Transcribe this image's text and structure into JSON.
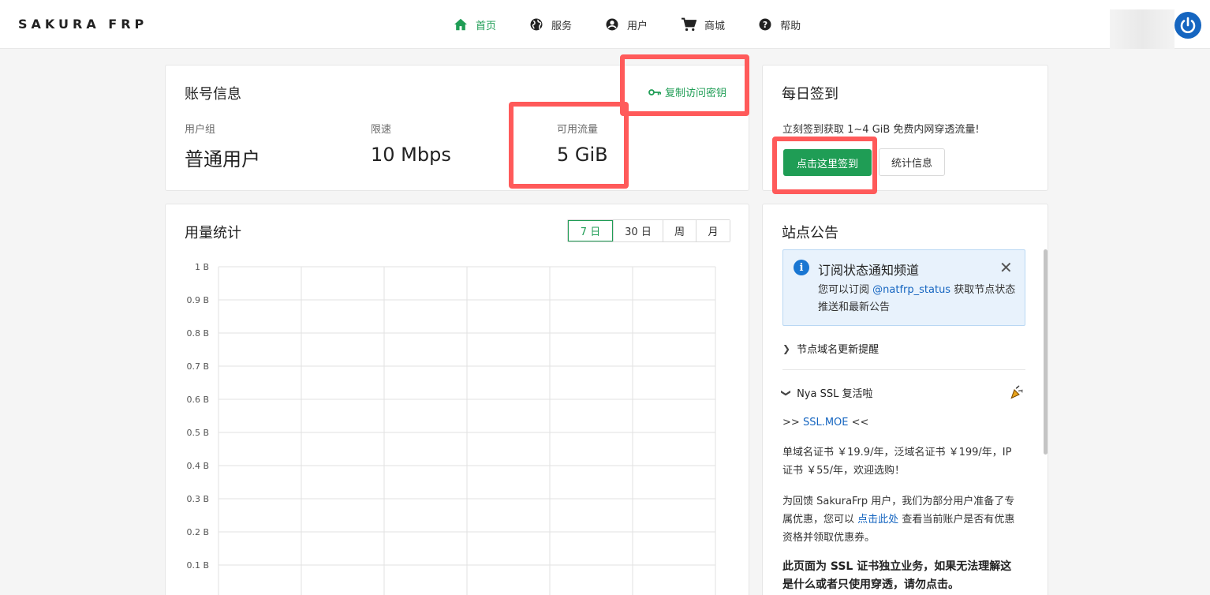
{
  "header": {
    "brand": "SAKURA FRP",
    "nav": [
      {
        "label": "首页",
        "icon": "home-icon",
        "active": true
      },
      {
        "label": "服务",
        "icon": "globe-icon",
        "active": false
      },
      {
        "label": "用户",
        "icon": "account-circle-icon",
        "active": false
      },
      {
        "label": "商城",
        "icon": "cart-icon",
        "active": false
      },
      {
        "label": "帮助",
        "icon": "help-circle-icon",
        "active": false
      }
    ],
    "power_icon": "power-icon"
  },
  "account": {
    "title": "账号信息",
    "copy_key_label": "复制访问密钥",
    "stats": [
      {
        "label": "用户组",
        "value": "普通用户"
      },
      {
        "label": "限速",
        "value": "10 Mbps"
      },
      {
        "label": "可用流量",
        "value": "5 GiB"
      }
    ]
  },
  "checkin": {
    "title": "每日签到",
    "description": "立刻签到获取 1~4 GiB 免费内网穿透流量!",
    "checkin_button": "点击这里签到",
    "stats_button": "统计信息"
  },
  "usage": {
    "title": "用量统计",
    "ranges": [
      "7 日",
      "30 日",
      "周",
      "月"
    ],
    "active_range": "7 日"
  },
  "chart_data": {
    "type": "line",
    "title": "",
    "ylim": [
      0,
      1
    ],
    "y_ticks": [
      "1 B",
      "0.9 B",
      "0.8 B",
      "0.7 B",
      "0.6 B",
      "0.5 B",
      "0.4 B",
      "0.3 B",
      "0.2 B",
      "0.1 B"
    ],
    "series": [],
    "grid": true
  },
  "notice": {
    "title": "站点公告",
    "alert": {
      "title": "订阅状态通知频道",
      "body_prefix": "您可以订阅",
      "link": "@natfrp_status",
      "body_suffix": "获取节点状态推送和最新公告"
    },
    "collapsed_item": "节点域名更新提醒",
    "expanded_item": "Nya SSL 复活啦",
    "ssl_prefix": ">>",
    "ssl_link": "SSL.MOE",
    "ssl_suffix": "<<",
    "price_text": "单域名证书 ￥19.9/年，泛域名证书 ￥199/年，IP 证书 ￥55/年，欢迎选购！",
    "offer_prefix": "为回馈 SakuraFrp 用户，我们为部分用户准备了专属优惠，您可以",
    "offer_link": "点击此处",
    "offer_suffix": "查看当前账户是否有优惠资格并领取优惠券。",
    "warning_text": "此页面为 SSL 证书独立业务，如果无法理解这是什么或者只使用穿透，请勿点击。"
  },
  "colors": {
    "accent": "#1f9d55",
    "link": "#1565c0",
    "highlight": "#ff5a5a",
    "power": "#1565c0"
  }
}
